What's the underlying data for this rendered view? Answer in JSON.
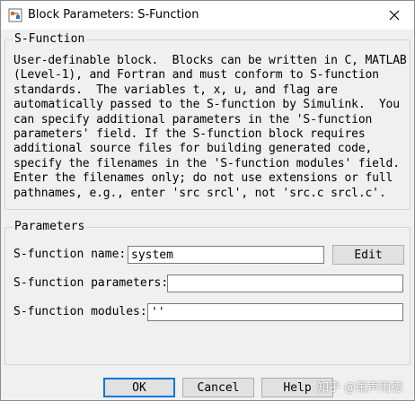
{
  "window": {
    "title": "Block Parameters: S-Function",
    "close_glyph": "✕"
  },
  "description_group": {
    "legend": "S-Function",
    "text": "User-definable block.  Blocks can be written in C, MATLAB\n(Level-1), and Fortran and must conform to S-function\nstandards.  The variables t, x, u, and flag are\nautomatically passed to the S-function by Simulink.  You\ncan specify additional parameters in the 'S-function\nparameters' field. If the S-function block requires\nadditional source files for building generated code,\nspecify the filenames in the 'S-function modules' field.\nEnter the filenames only; do not use extensions or full\npathnames, e.g., enter 'src srcl', not 'src.c srcl.c'."
  },
  "parameters_group": {
    "legend": "Parameters",
    "name_label": "S-function name:",
    "name_value": "system",
    "edit_button": "Edit",
    "params_label": "S-function parameters:",
    "params_value": "",
    "modules_label": "S-function modules:",
    "modules_value": "''"
  },
  "buttons": {
    "ok": "OK",
    "cancel": "Cancel",
    "help": "Help"
  },
  "watermark": "知乎 @箫声雨德",
  "icons": {
    "app": "simulink-app-icon",
    "close": "close-icon"
  }
}
